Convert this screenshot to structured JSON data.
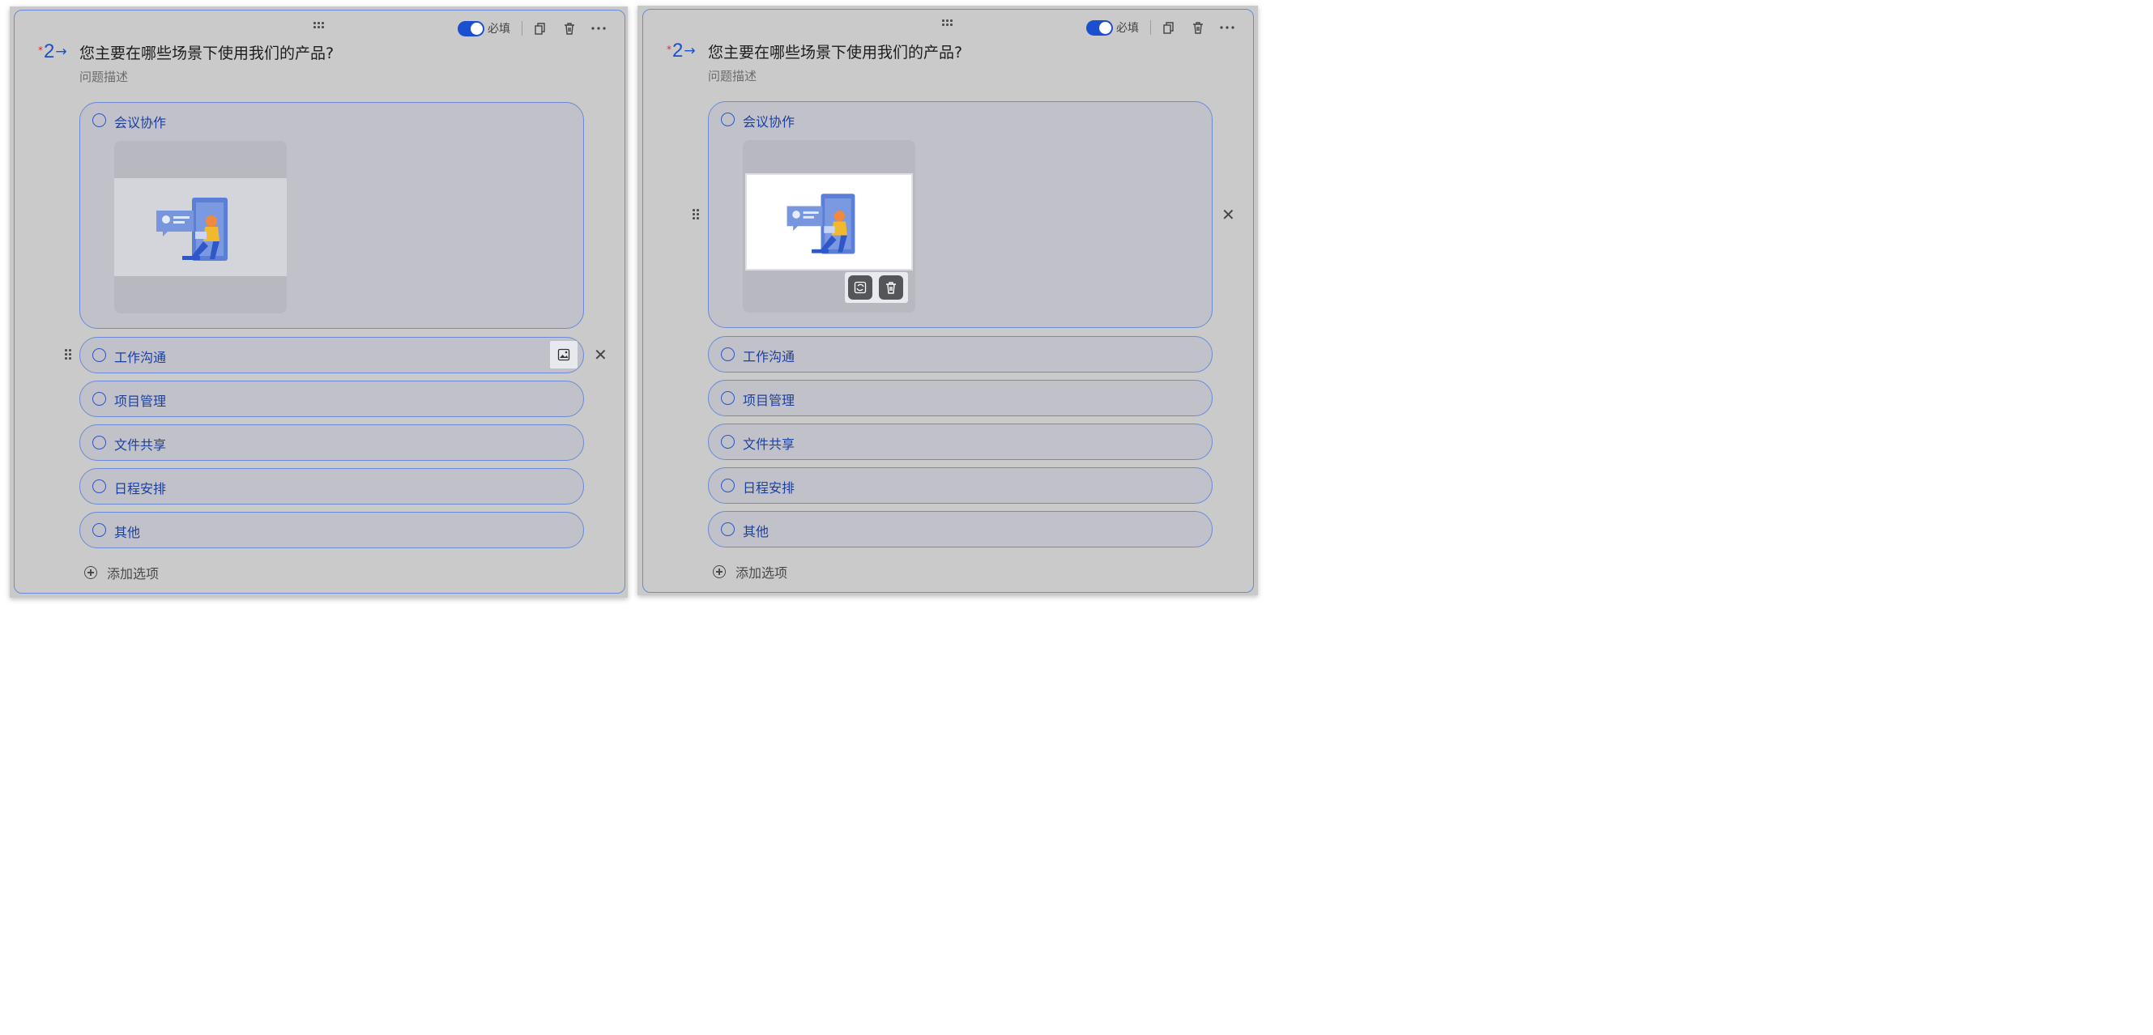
{
  "question": {
    "required_label": "必填",
    "required_mark": "*",
    "number": "2",
    "arrow": "→",
    "title": "您主要在哪些场景下使用我们的产品?",
    "description": "问题描述"
  },
  "options": [
    {
      "label": "会议协作"
    },
    {
      "label": "工作沟通"
    },
    {
      "label": "项目管理"
    },
    {
      "label": "文件共享"
    },
    {
      "label": "日程安排"
    },
    {
      "label": "其他"
    }
  ],
  "add_option_label": "添加选项",
  "close_glyph": "✕",
  "colors": {
    "accent": "#1a4fd0",
    "border": "#6a8ad8",
    "required": "#e0282e"
  },
  "icons": [
    "drag-handle-icon",
    "toggle",
    "copy-icon",
    "trash-icon",
    "more-icon",
    "image-icon",
    "replace-image-icon",
    "plus-circle-icon",
    "close-icon"
  ]
}
